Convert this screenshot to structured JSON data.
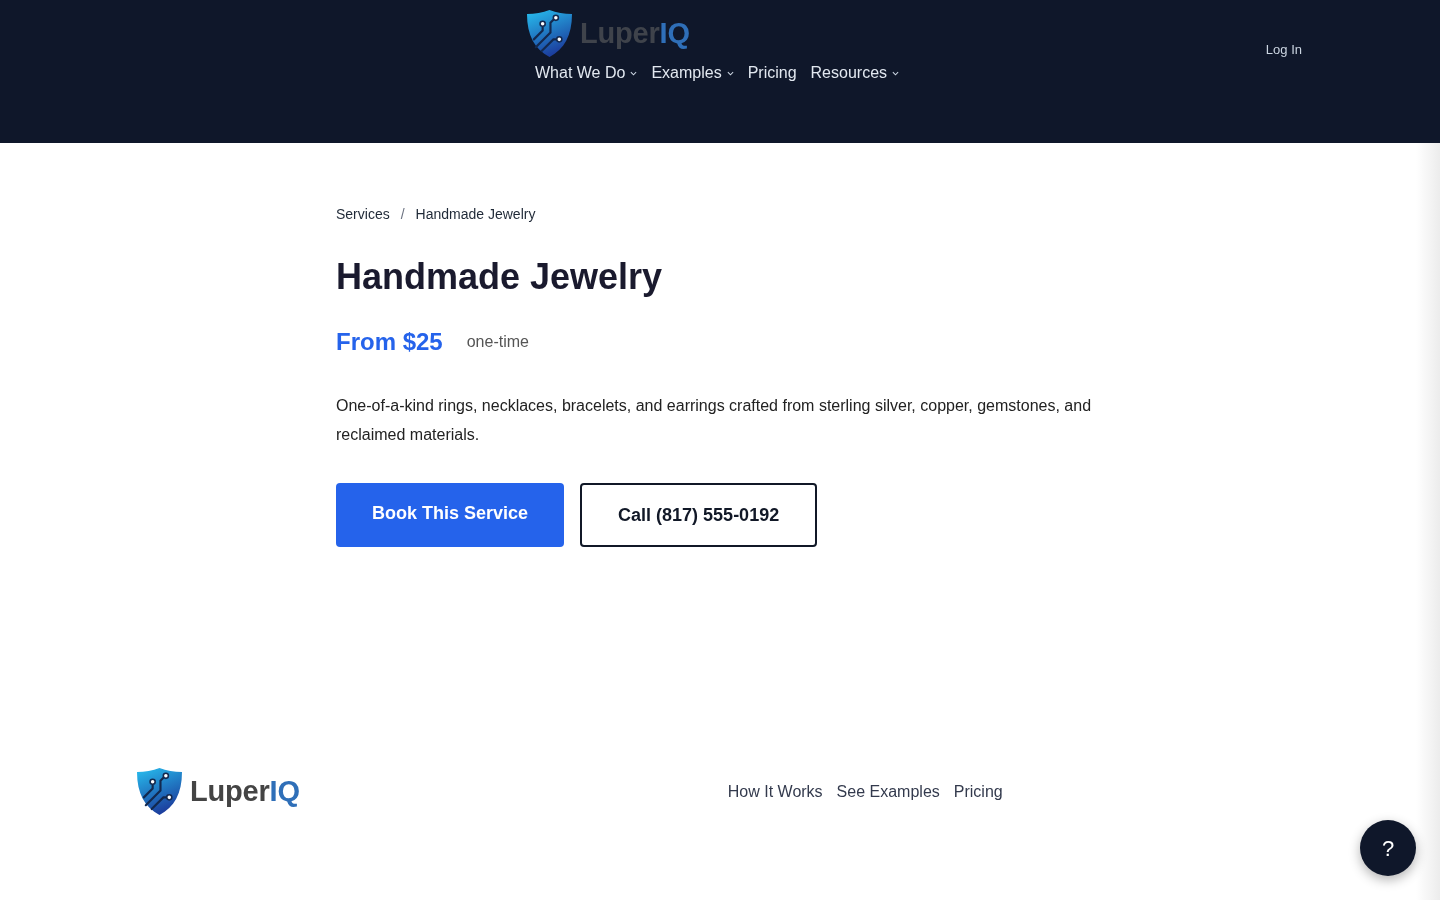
{
  "header": {
    "logo": {
      "name_parts": [
        "Luper",
        "IQ"
      ]
    },
    "nav": [
      {
        "label": "What We Do",
        "dropdown": true
      },
      {
        "label": "Examples",
        "dropdown": true
      },
      {
        "label": "Pricing",
        "dropdown": false
      },
      {
        "label": "Resources",
        "dropdown": true
      }
    ],
    "login": "Log In"
  },
  "breadcrumb": {
    "items": [
      "Services",
      "Handmade Jewelry"
    ],
    "separator": "/"
  },
  "title": "Handmade Jewelry",
  "price": {
    "amount": "From $25",
    "period": "one-time"
  },
  "description": "One-of-a-kind rings, necklaces, bracelets, and earrings crafted from sterling silver, copper, gemstones, and reclaimed materials.",
  "actions": [
    {
      "label": "Book This Service",
      "kind": "primary"
    },
    {
      "label": "Call (817) 555-0192",
      "kind": "outline"
    }
  ],
  "footer": {
    "logo": {
      "name_parts": [
        "Luper",
        "IQ"
      ]
    },
    "links": [
      "How It Works",
      "See Examples",
      "Pricing"
    ]
  },
  "help_button": {
    "label": "?"
  }
}
